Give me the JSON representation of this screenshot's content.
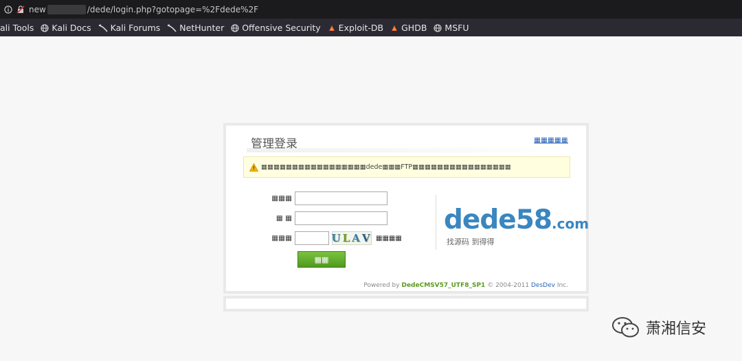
{
  "browser": {
    "url_prefix": "new",
    "url_path": "/dede/login.php?gotopage=%2Fdede%2F",
    "bookmarks": [
      {
        "label": "ali Tools",
        "icon": "none"
      },
      {
        "label": "Kali Docs",
        "icon": "globe-icon"
      },
      {
        "label": "Kali Forums",
        "icon": "kali-icon"
      },
      {
        "label": "NetHunter",
        "icon": "kali-icon"
      },
      {
        "label": "Offensive Security",
        "icon": "globe-icon"
      },
      {
        "label": "Exploit-DB",
        "icon": "exploit-icon"
      },
      {
        "label": "GHDB",
        "icon": "exploit-icon"
      },
      {
        "label": "MSFU",
        "icon": "globe-icon"
      }
    ]
  },
  "login": {
    "title": "管理登录",
    "top_link": "▦▦▦▦▦",
    "warning": "▦▦▦▦▦▦▦▦▦▦▦▦▦▦▦▦▦dede▦▦▦FTP▦▦▦▦▦▦▦▦▦▦▦▦▦▦▦▦",
    "username_label": "▦▦▦",
    "password_label": "▦ ▦",
    "captcha_label": "▦▦▦",
    "captcha_text": [
      "U",
      "L",
      "A",
      "V"
    ],
    "refresh_label": "▦▦▦▦",
    "submit_label": "▦▦"
  },
  "logo": {
    "main": "dede58",
    "domain": ".com",
    "slogan": "找源码  到得得"
  },
  "footer": {
    "powered_by": "Powered by",
    "version": "DedeCMSV57_UTF8_SP1",
    "copyright": "© 2004-2011",
    "dev": "DesDev",
    "inc": "Inc."
  },
  "watermark": {
    "text": "萧湘信安"
  },
  "colors": {
    "accent": "#3a86c0",
    "button": "#5aa428",
    "warning_bg": "#ffffe0"
  }
}
